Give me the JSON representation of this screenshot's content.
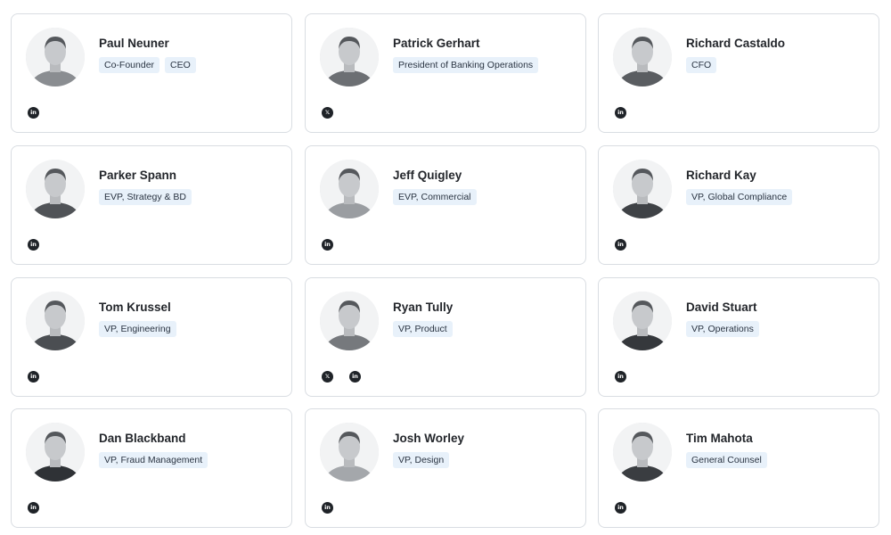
{
  "team": [
    {
      "name": "Paul Neuner",
      "tags": [
        "Co-Founder",
        "CEO"
      ],
      "socials": [
        {
          "icon": "linkedin-icon",
          "glyph": "in"
        }
      ],
      "shade": "#8a8d91"
    },
    {
      "name": "Patrick Gerhart",
      "tags": [
        "President of Banking Operations"
      ],
      "socials": [
        {
          "icon": "x-twitter-icon",
          "glyph": "𝕏"
        }
      ],
      "shade": "#6c6f73"
    },
    {
      "name": "Richard Castaldo",
      "tags": [
        "CFO"
      ],
      "socials": [
        {
          "icon": "linkedin-icon",
          "glyph": "in"
        }
      ],
      "shade": "#5a5d61"
    },
    {
      "name": "Parker Spann",
      "tags": [
        "EVP, Strategy & BD"
      ],
      "socials": [
        {
          "icon": "linkedin-icon",
          "glyph": "in"
        }
      ],
      "shade": "#505357"
    },
    {
      "name": "Jeff Quigley",
      "tags": [
        "EVP, Commercial"
      ],
      "socials": [
        {
          "icon": "linkedin-icon",
          "glyph": "in"
        }
      ],
      "shade": "#9a9da1"
    },
    {
      "name": "Richard Kay",
      "tags": [
        "VP, Global Compliance"
      ],
      "socials": [
        {
          "icon": "linkedin-icon",
          "glyph": "in"
        }
      ],
      "shade": "#3f4246"
    },
    {
      "name": "Tom Krussel",
      "tags": [
        "VP, Engineering"
      ],
      "socials": [
        {
          "icon": "linkedin-icon",
          "glyph": "in"
        }
      ],
      "shade": "#4b4e52"
    },
    {
      "name": "Ryan Tully",
      "tags": [
        "VP, Product"
      ],
      "socials": [
        {
          "icon": "x-twitter-icon",
          "glyph": "𝕏"
        },
        {
          "icon": "linkedin-icon",
          "glyph": "in"
        }
      ],
      "shade": "#76797d"
    },
    {
      "name": "David Stuart",
      "tags": [
        "VP, Operations"
      ],
      "socials": [
        {
          "icon": "linkedin-icon",
          "glyph": "in"
        }
      ],
      "shade": "#35383c"
    },
    {
      "name": "Dan Blackband",
      "tags": [
        "VP, Fraud Management"
      ],
      "socials": [
        {
          "icon": "linkedin-icon",
          "glyph": "in"
        }
      ],
      "shade": "#2f3236"
    },
    {
      "name": "Josh Worley",
      "tags": [
        "VP, Design"
      ],
      "socials": [
        {
          "icon": "linkedin-icon",
          "glyph": "in"
        }
      ],
      "shade": "#a4a7ab"
    },
    {
      "name": "Tim Mahota",
      "tags": [
        "General Counsel"
      ],
      "socials": [
        {
          "icon": "linkedin-icon",
          "glyph": "in"
        }
      ],
      "shade": "#3a3d41"
    }
  ]
}
